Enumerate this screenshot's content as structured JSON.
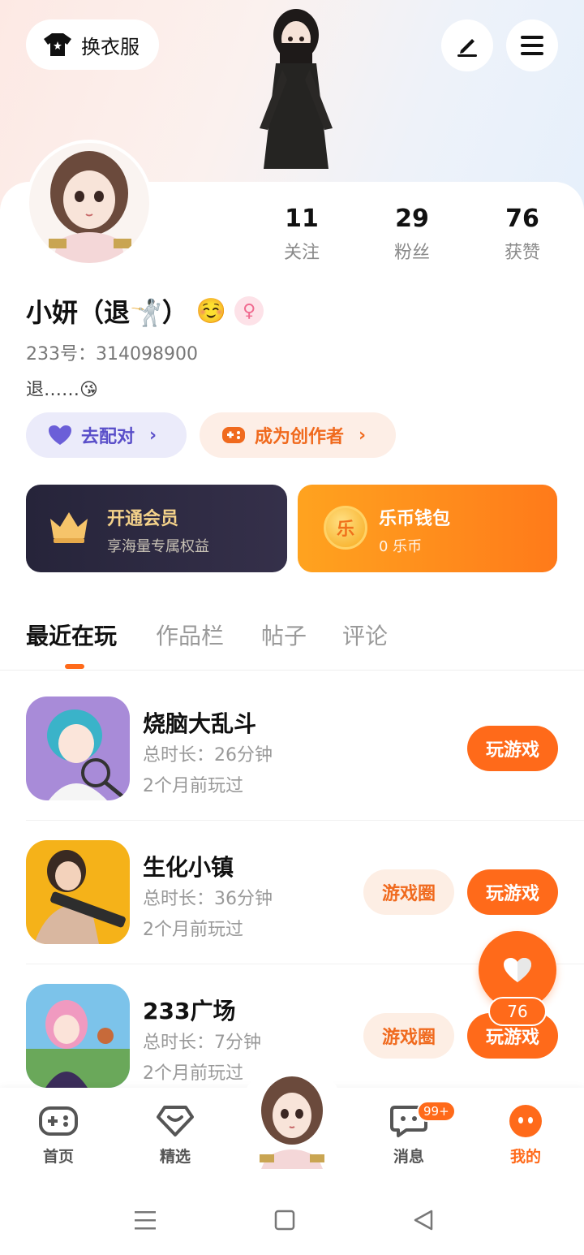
{
  "header": {
    "outfit_label": "换衣服"
  },
  "profile": {
    "stats": [
      {
        "value": "11",
        "label": "关注"
      },
      {
        "value": "29",
        "label": "粉丝"
      },
      {
        "value": "76",
        "label": "获赞"
      }
    ],
    "name": "小妍（退🤺）",
    "emoji": "☺️",
    "gender_symbol": "♀",
    "uid": "233号：314098900",
    "bio": "退……😘",
    "match_label": "去配对",
    "creator_label": "成为创作者"
  },
  "vip": {
    "title": "开通会员",
    "subtitle": "享海量专属权益"
  },
  "wallet": {
    "title": "乐币钱包",
    "subtitle": "0 乐币",
    "coin_char": "乐"
  },
  "tabs": [
    "最近在玩",
    "作品栏",
    "帖子",
    "评论"
  ],
  "games": [
    {
      "name": "烧脑大乱斗",
      "duration": "总时长：26分钟",
      "last_played": "2个月前玩过",
      "play_label": "玩游戏"
    },
    {
      "name": "生化小镇",
      "duration": "总时长：36分钟",
      "last_played": "2个月前玩过",
      "circle_label": "游戏圈",
      "play_label": "玩游戏"
    },
    {
      "name": "233广场",
      "duration": "总时长：7分钟",
      "last_played": "2个月前玩过",
      "circle_label": "游戏圈",
      "play_label": "玩游戏"
    }
  ],
  "like_count": "76",
  "bottom_nav": [
    {
      "label": "首页"
    },
    {
      "label": "精选"
    },
    {
      "label": "消息",
      "badge": "99+"
    },
    {
      "label": "我的"
    }
  ],
  "colors": {
    "accent": "#ff6a1a",
    "vip_bg": "#26243a",
    "match_purple": "#5a4fc9"
  }
}
